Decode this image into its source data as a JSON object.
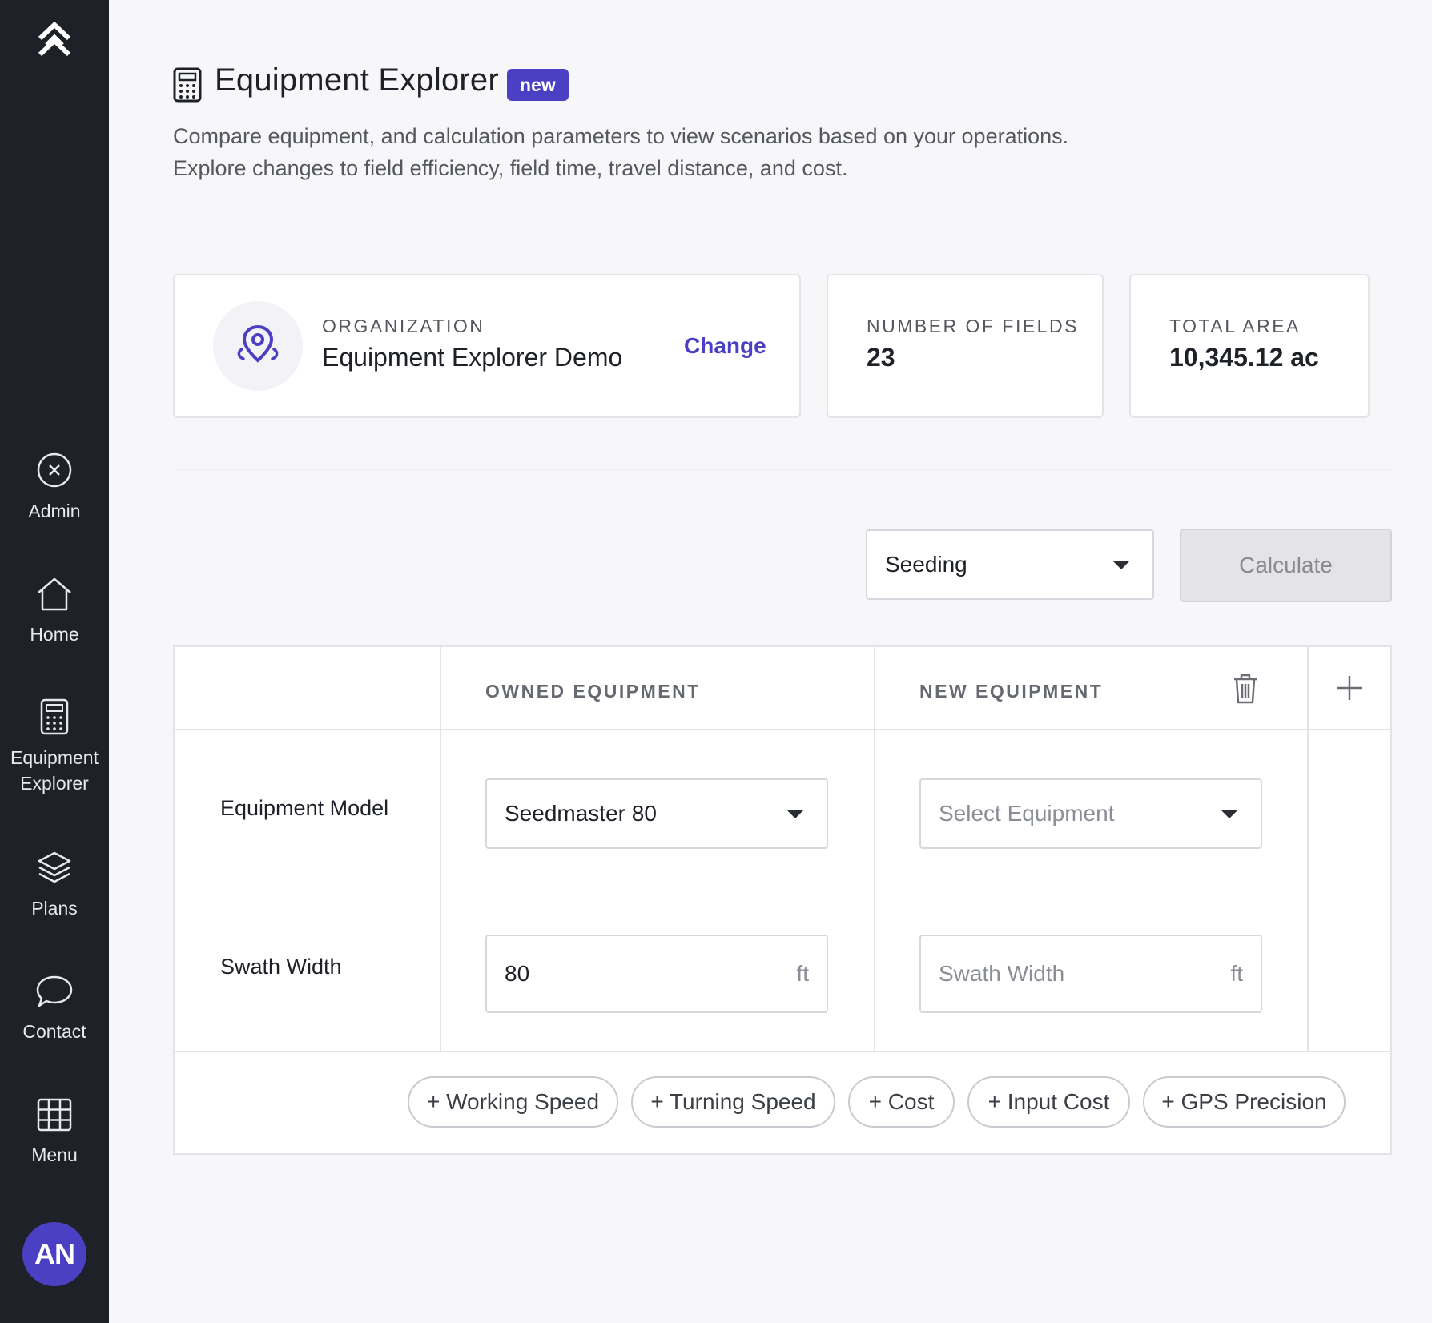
{
  "sidebar": {
    "logo_icon": "chevrons-up-logo",
    "items": [
      {
        "label": "Admin",
        "icon": "circle-x-icon"
      },
      {
        "label": "Home",
        "icon": "home-icon"
      },
      {
        "label": "Equipment\nExplorer",
        "label_line1": "Equipment",
        "label_line2": "Explorer",
        "icon": "calculator-icon"
      },
      {
        "label": "Plans",
        "icon": "layers-icon"
      },
      {
        "label": "Contact",
        "icon": "chat-bubble-icon"
      },
      {
        "label": "Menu",
        "icon": "grid-icon"
      }
    ],
    "avatar_initials": "AN"
  },
  "header": {
    "title": "Equipment Explorer",
    "badge": "new",
    "description_line1": "Compare equipment, and calculation parameters to view scenarios based on your operations.",
    "description_line2": "Explore changes to field efficiency, field time, travel distance, and cost."
  },
  "cards": {
    "organization": {
      "label": "ORGANIZATION",
      "value": "Equipment Explorer Demo",
      "action": "Change"
    },
    "fields": {
      "label": "NUMBER OF FIELDS",
      "value": "23"
    },
    "area": {
      "label": "TOTAL AREA",
      "value": "10,345.12 ac"
    }
  },
  "controls": {
    "operation_select": "Seeding",
    "calculate_label": "Calculate"
  },
  "table": {
    "columns": [
      "OWNED EQUIPMENT",
      "NEW EQUIPMENT"
    ],
    "rows": [
      {
        "label": "Equipment Model",
        "owned": "Seedmaster 80",
        "new_placeholder": "Select Equipment"
      },
      {
        "label": "Swath Width",
        "owned": "80",
        "owned_unit": "ft",
        "new_placeholder": "Swath Width",
        "new_unit": "ft"
      }
    ],
    "add_buttons": [
      "+ Working Speed",
      "+ Turning Speed",
      "+ Cost",
      "+ Input Cost",
      "+ GPS Precision"
    ]
  },
  "colors": {
    "accent": "#4b3fc4",
    "sidebar_bg": "#1f2128",
    "page_bg": "#f7f7fa"
  }
}
